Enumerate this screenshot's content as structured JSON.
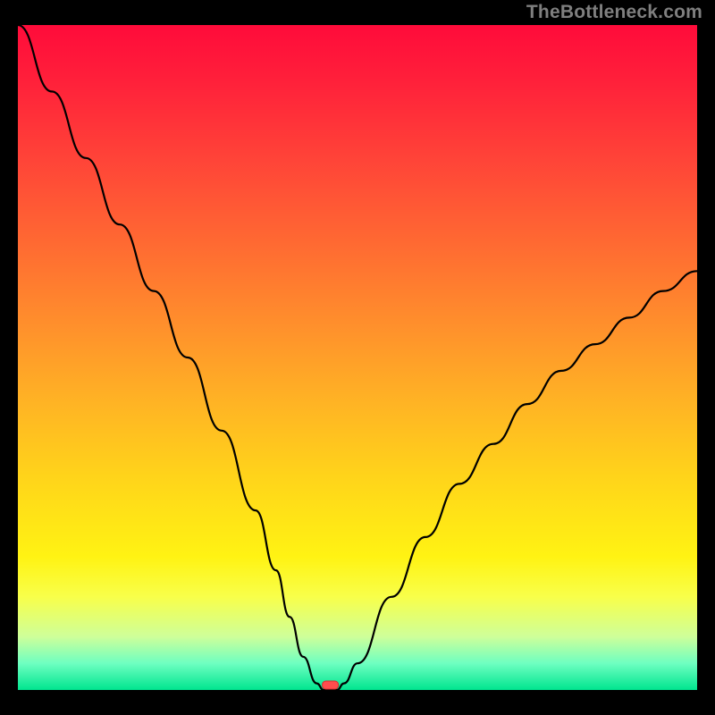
{
  "watermark": "TheBottleneck.com",
  "chart_data": {
    "type": "line",
    "title": "",
    "xlabel": "",
    "ylabel": "",
    "xlim": [
      0,
      100
    ],
    "ylim": [
      0,
      100
    ],
    "grid": false,
    "legend": false,
    "series": [
      {
        "name": "bottleneck-curve",
        "x": [
          0,
          5,
          10,
          15,
          20,
          25,
          30,
          35,
          38,
          40,
          42,
          44,
          45,
          47,
          48,
          50,
          55,
          60,
          65,
          70,
          75,
          80,
          85,
          90,
          95,
          100
        ],
        "values": [
          100,
          90,
          80,
          70,
          60,
          50,
          39,
          27,
          18,
          11,
          5,
          1,
          0,
          0,
          1,
          4,
          14,
          23,
          31,
          37,
          43,
          48,
          52,
          56,
          60,
          63
        ]
      }
    ],
    "marker": {
      "x": 46,
      "y": 0,
      "label": "optimal-point"
    },
    "background_gradient_stops": [
      {
        "pos": 0,
        "color": "#ff0b3a"
      },
      {
        "pos": 8,
        "color": "#ff1f3a"
      },
      {
        "pos": 20,
        "color": "#ff4338"
      },
      {
        "pos": 33,
        "color": "#ff6a32"
      },
      {
        "pos": 45,
        "color": "#ff8f2c"
      },
      {
        "pos": 57,
        "color": "#ffb424"
      },
      {
        "pos": 68,
        "color": "#ffd41a"
      },
      {
        "pos": 80,
        "color": "#fff313"
      },
      {
        "pos": 86,
        "color": "#f8ff4a"
      },
      {
        "pos": 92,
        "color": "#ceff9a"
      },
      {
        "pos": 96,
        "color": "#6effc1"
      },
      {
        "pos": 100,
        "color": "#00e58f"
      }
    ]
  }
}
